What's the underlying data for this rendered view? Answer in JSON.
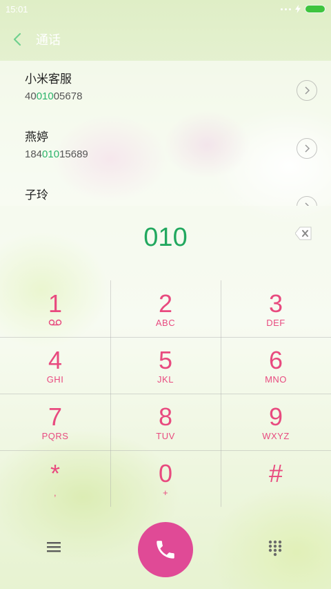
{
  "status_bar": {
    "time": "15:01"
  },
  "header": {
    "title": "通话"
  },
  "results": [
    {
      "name": "小米客服",
      "number_before": "40",
      "number_match": "010",
      "number_after": "05678"
    },
    {
      "name": "燕婷",
      "number_before": "184",
      "number_match": "010",
      "number_after": "15689"
    },
    {
      "name": "子玲",
      "number_before": "",
      "number_match": "",
      "number_after": ""
    }
  ],
  "dialer": {
    "number": "010"
  },
  "keys": [
    {
      "digit": "1",
      "letters": ""
    },
    {
      "digit": "2",
      "letters": "ABC"
    },
    {
      "digit": "3",
      "letters": "DEF"
    },
    {
      "digit": "4",
      "letters": "GHI"
    },
    {
      "digit": "5",
      "letters": "JKL"
    },
    {
      "digit": "6",
      "letters": "MNO"
    },
    {
      "digit": "7",
      "letters": "PQRS"
    },
    {
      "digit": "8",
      "letters": "TUV"
    },
    {
      "digit": "9",
      "letters": "WXYZ"
    },
    {
      "digit": "*",
      "letters": ","
    },
    {
      "digit": "0",
      "letters": "+"
    },
    {
      "digit": "#",
      "letters": ""
    }
  ],
  "colors": {
    "accent_pink": "#e84a7f",
    "match_green": "#2bb46b",
    "call_button": "#e04a96"
  },
  "icons": {
    "back": "chevron-left-icon",
    "detail": "chevron-right-icon",
    "backspace": "backspace-icon",
    "voicemail": "voicemail-icon",
    "menu": "menu-icon",
    "call": "phone-icon",
    "keypad": "dialpad-icon"
  }
}
